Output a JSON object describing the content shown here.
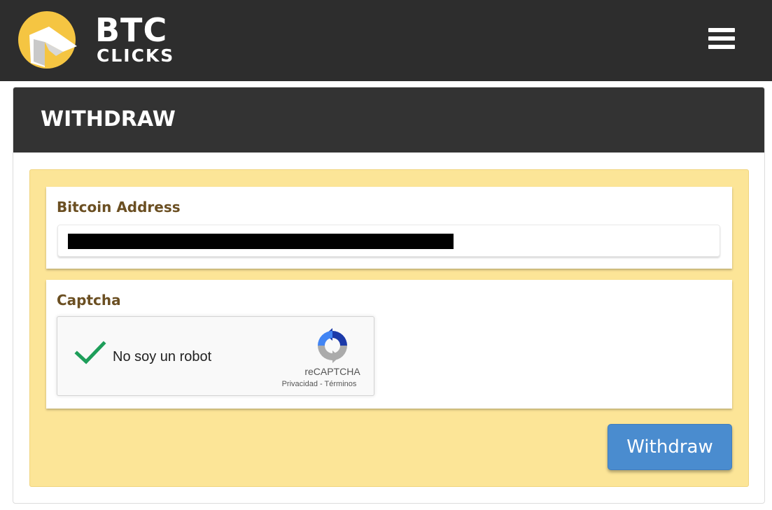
{
  "header": {
    "logo_big": "BTC",
    "logo_small": "CLICKS",
    "brand_color": "#f5c542",
    "menu_icon": "hamburger-menu-icon"
  },
  "panel": {
    "title": "WITHDRAW"
  },
  "address": {
    "label": "Bitcoin Address",
    "value_redacted": true
  },
  "captcha": {
    "label": "Captcha",
    "checkbox_label": "No soy un robot",
    "checked": true,
    "brand": "reCAPTCHA",
    "privacy_link": "Privacidad",
    "separator": "-",
    "terms_link": "Términos"
  },
  "actions": {
    "withdraw_label": "Withdraw",
    "withdraw_color": "#4a8ccf"
  }
}
